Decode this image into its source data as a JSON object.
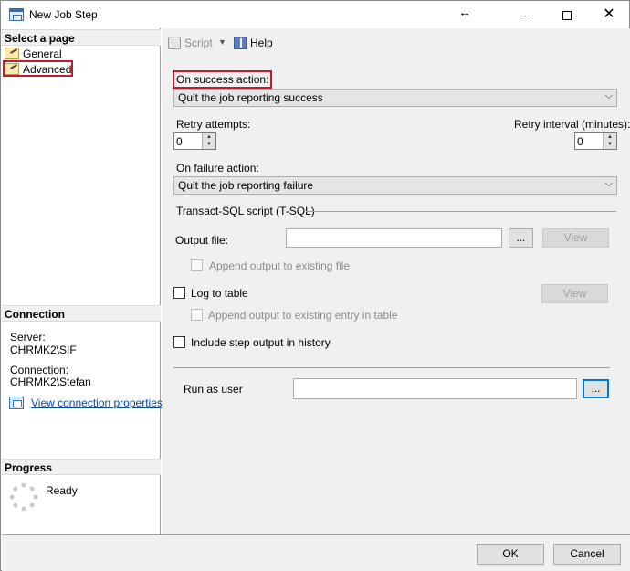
{
  "window": {
    "title": "New Job Step",
    "resize_glyph": "↔",
    "close_glyph": "✕"
  },
  "left": {
    "select_page_header": "Select a page",
    "pages": [
      {
        "label": "General",
        "icon": "wrench-page-icon",
        "selected": false
      },
      {
        "label": "Advanced",
        "icon": "wrench-page-icon",
        "selected": true
      }
    ],
    "connection_header": "Connection",
    "server_label": "Server:",
    "server_value": "CHRMK2\\SIF",
    "connection_label": "Connection:",
    "connection_value": "CHRMK2\\Stefan",
    "view_connection_link": "View connection properties",
    "progress_header": "Progress",
    "progress_status": "Ready"
  },
  "toolbar": {
    "script_label": "Script",
    "script_caret": "▼",
    "help_label": "Help"
  },
  "form": {
    "on_success_label": "On success action:",
    "on_success_value": "Quit the job reporting success",
    "retry_attempts_label": "Retry attempts:",
    "retry_attempts_value": "0",
    "retry_interval_label": "Retry interval (minutes):",
    "retry_interval_value": "0",
    "on_failure_label": "On failure action:",
    "on_failure_value": "Quit the job reporting failure",
    "tsql_group_label": "Transact-SQL script (T-SQL)",
    "output_file_label": "Output file:",
    "output_file_value": "",
    "browse_label": "...",
    "view_label": "View",
    "append_output_label": "Append output to existing file",
    "log_to_table_label": "Log to table",
    "log_view_label": "View",
    "append_table_label": "Append output to existing entry in table",
    "include_history_label": "Include step output in history",
    "run_as_user_label": "Run as user",
    "run_as_user_value": "",
    "run_as_browse_label": "..."
  },
  "combo_arrow": "⌵",
  "spin_up": "▲",
  "spin_down": "▼",
  "buttons": {
    "ok_label": "OK",
    "cancel_label": "Cancel"
  }
}
